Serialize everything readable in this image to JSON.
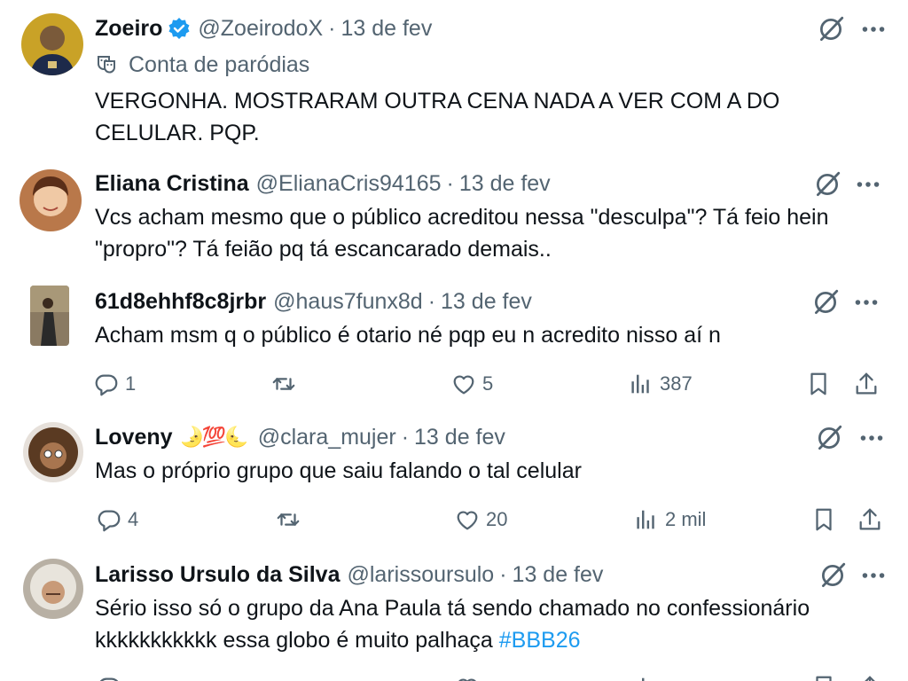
{
  "tweets": [
    {
      "name": "Zoeiro",
      "handle": "@ZoeirodoX",
      "dot": "·",
      "date": "13 de fev",
      "parody_label": "Conta de paródias",
      "text": "VERGONHA. MOSTRARAM OUTRA CENA NADA A VER COM A DO CELULAR. PQP.",
      "verified": true
    },
    {
      "name": "Eliana Cristina",
      "handle": "@ElianaCris94165",
      "dot": "·",
      "date": "13 de fev",
      "text": "Vcs acham mesmo que o público acreditou nessa \"desculpa\"? Tá feio hein \"propro\"? Tá feião pq tá escancarado demais.."
    },
    {
      "name": "61d8ehhf8c8jrbr",
      "handle": "@haus7funx8d",
      "dot": "·",
      "date": "13 de fev",
      "text": "Acham msm q o público é otario né  pqp eu n acredito nisso aí n",
      "replies": "1",
      "likes": "5",
      "views": "387"
    },
    {
      "name": "Loveny",
      "emoji": "🌛💯🌜",
      "handle": "@clara_mujer",
      "dot": "·",
      "date": "13 de fev",
      "text": "Mas o próprio grupo que saiu falando o tal celular",
      "replies": "4",
      "likes": "20",
      "views": "2 mil"
    },
    {
      "name": "Larisso Ursulo da Silva",
      "handle": "@larissoursulo",
      "dot": "·",
      "date": "13 de fev",
      "text": "Sério isso só o grupo da Ana Paula tá sendo chamado no confessionário kkkkkkkkkkk essa globo é muito palhaça",
      "hashtag": "#BBB26"
    }
  ],
  "icons": {
    "verified": "verified-badge-icon",
    "parody": "theater-masks-icon",
    "grok": "grok-icon",
    "more": "more-dots-icon",
    "reply": "reply-icon",
    "retweet": "retweet-icon",
    "like": "heart-icon",
    "views": "views-icon",
    "bookmark": "bookmark-icon",
    "share": "share-icon"
  },
  "colors": {
    "text": "#0f1419",
    "secondary": "#536471",
    "link": "#1d9bf0",
    "verified": "#1d9bf0"
  }
}
